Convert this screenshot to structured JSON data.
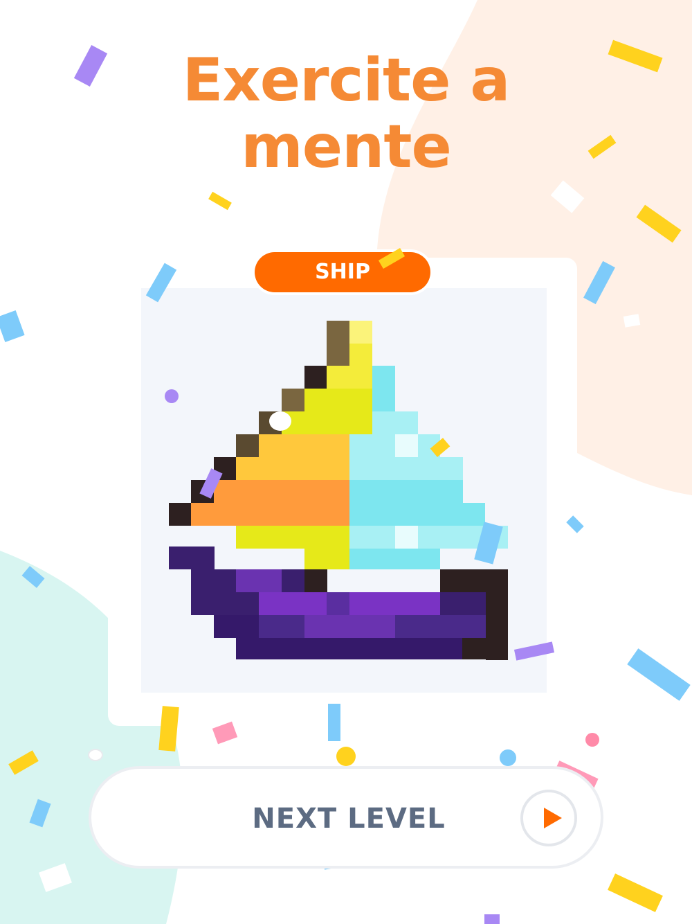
{
  "headline": {
    "line1": "Exercite a",
    "line2": "mente"
  },
  "puzzle": {
    "tag_label": "SHIP",
    "icon": "pixel-art-sailboat"
  },
  "next_level": {
    "label": "NEXT LEVEL",
    "icon": "play-icon"
  },
  "colors": {
    "headline": "#f58a35",
    "tag": "#ff6a00",
    "button_text": "#5c6b82",
    "peach_blob": "#fff0e6",
    "mint_blob": "#d8f5f1"
  }
}
